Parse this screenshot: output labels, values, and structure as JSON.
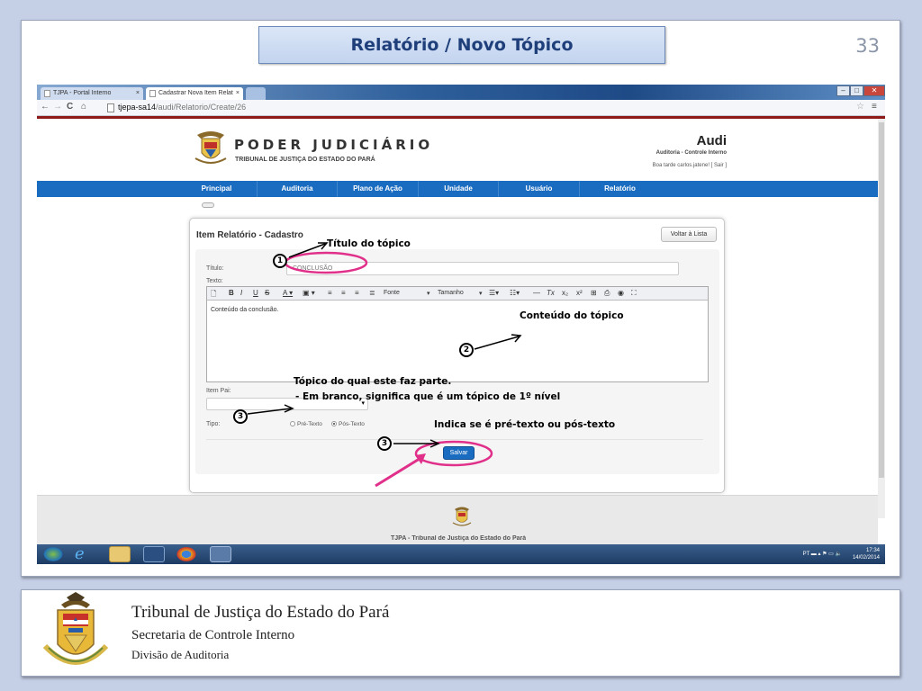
{
  "slide": {
    "title": "Relatório / Novo Tópico",
    "number": "33"
  },
  "browser": {
    "tab1": "TJPA - Portal Interno",
    "tab2": "Cadastrar Nova Item Relat",
    "tab_close": "×",
    "url_host": "tjepa-sa14",
    "url_path": "/audi/Relatorio/Create/26"
  },
  "header": {
    "org_title": "PODER JUDICIÁRIO",
    "org_subtitle": "TRIBUNAL DE JUSTIÇA DO ESTADO DO PARÁ",
    "app_name": "Audi",
    "app_desc": "Auditoria - Controle Interno",
    "greeting": "Boa tarde carlos.jatene! [ Sair ]"
  },
  "nav": {
    "items": [
      "Principal",
      "Auditoria",
      "Plano de Ação",
      "Unidade",
      "Usuário",
      "Relatório"
    ]
  },
  "form": {
    "title": "Item Relatório - Cadastro",
    "back_label": "Voltar à Lista",
    "titulo_label": "Título:",
    "titulo_value": "CONCLUSÃO",
    "texto_label": "Texto:",
    "font_label": "Fonte",
    "size_label": "Tamanho",
    "editor_text": "Conteúdo da conclusão.",
    "item_pai_label": "Item Pai:",
    "tipo_label": "Tipo:",
    "pre_texto": "Pré-Texto",
    "pos_texto": "Pós-Texto",
    "save_label": "Salvar"
  },
  "footer": {
    "text": "TJPA - Tribunal de Justiça do Estado do Pará"
  },
  "taskbar": {
    "lang": "PT",
    "time": "17:34",
    "date": "14/02/2014"
  },
  "annotations": {
    "n1": "1",
    "n2": "2",
    "n3a": "3",
    "n3b": "3",
    "titulo": "Título do tópico",
    "conteudo": "Conteúdo do tópico",
    "pai_line1": "Tópico do qual  este faz parte.",
    "pai_line2": "- Em branco, significa que é um tópico de 1º nível",
    "tipo": "Indica se é pré-texto ou pós-texto"
  },
  "bottom": {
    "line1": "Tribunal de Justiça do Estado do  Pará",
    "line2": "Secretaria de Controle Interno",
    "line3": "Divisão de Auditoria"
  },
  "colors": {
    "nav_blue": "#1a6cc0",
    "highlight": "#e0308a",
    "title_blue": "#1f3f7a"
  }
}
